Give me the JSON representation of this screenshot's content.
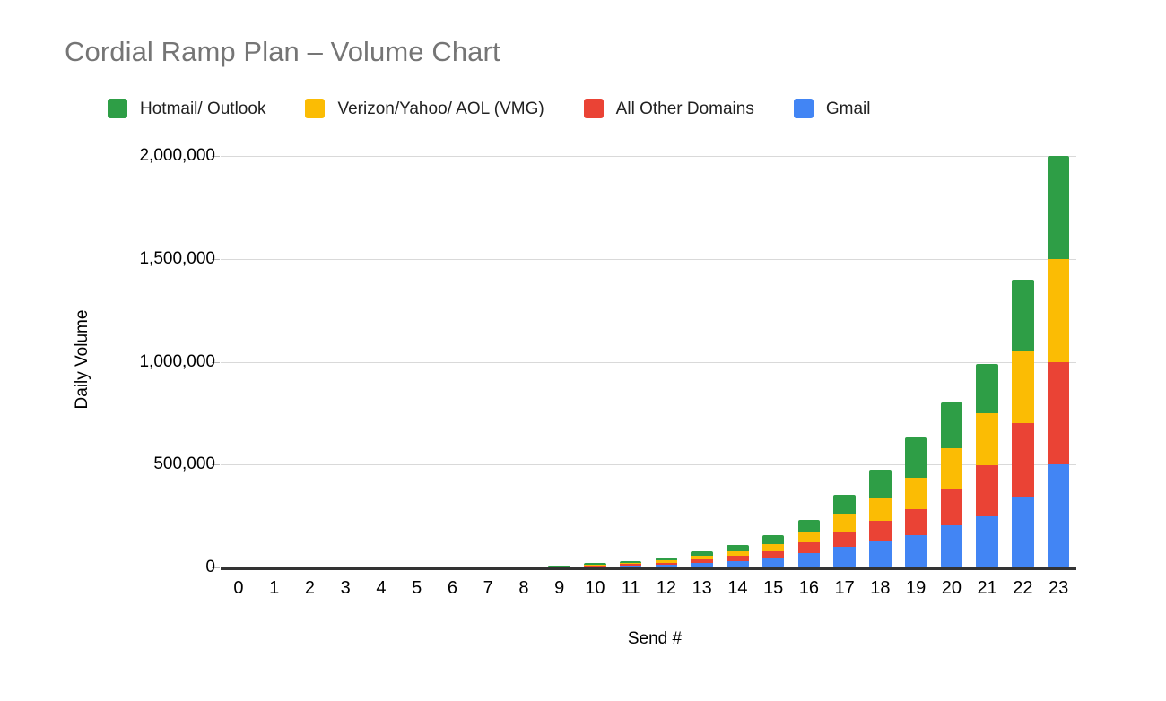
{
  "chart_data": {
    "type": "bar",
    "stacked": true,
    "title": "Cordial Ramp Plan – Volume Chart",
    "xlabel": "Send #",
    "ylabel": "Daily Volume",
    "ylim": [
      0,
      2000000
    ],
    "grid": true,
    "legend_position": "top",
    "categories": [
      "0",
      "1",
      "2",
      "3",
      "4",
      "5",
      "6",
      "7",
      "8",
      "9",
      "10",
      "11",
      "12",
      "13",
      "14",
      "15",
      "16",
      "17",
      "18",
      "19",
      "20",
      "21",
      "22",
      "23"
    ],
    "ytick_labels": [
      "0",
      "500,000",
      "1,000,000",
      "1,500,000",
      "2,000,000"
    ],
    "ytick_values": [
      0,
      500000,
      1000000,
      1500000,
      2000000
    ],
    "series": [
      {
        "name": "Gmail",
        "color": "#4285F4",
        "values": [
          0,
          0,
          0,
          0,
          0,
          0,
          0,
          0,
          0,
          1000,
          4000,
          8000,
          12000,
          20000,
          30000,
          45000,
          70000,
          100000,
          125000,
          155000,
          205000,
          250000,
          345000,
          500000
        ]
      },
      {
        "name": "All Other Domains",
        "color": "#EA4335",
        "values": [
          0,
          0,
          0,
          0,
          0,
          0,
          0,
          0,
          1000,
          2500,
          5000,
          8000,
          12000,
          18000,
          25000,
          35000,
          50000,
          75000,
          100000,
          130000,
          175000,
          245000,
          355000,
          500000
        ]
      },
      {
        "name": "Verizon/Yahoo/ AOL (VMG)",
        "color": "#FBBC04",
        "values": [
          0,
          0,
          0,
          0,
          0,
          0,
          0,
          0,
          2500,
          2500,
          5000,
          8000,
          12000,
          18000,
          25000,
          35000,
          55000,
          85000,
          115000,
          150000,
          200000,
          255000,
          350000,
          500000
        ]
      },
      {
        "name": "Hotmail/ Outlook",
        "color": "#2E9E46",
        "values": [
          0,
          0,
          0,
          0,
          0,
          0,
          0,
          0,
          1000,
          4000,
          6000,
          8000,
          14000,
          24000,
          30000,
          40000,
          55000,
          95000,
          135000,
          195000,
          220000,
          240000,
          350000,
          500000
        ]
      }
    ],
    "totals": [
      0,
      0,
      0,
      0,
      0,
      0,
      0,
      0,
      4500,
      10000,
      20000,
      32000,
      50000,
      80000,
      110000,
      155000,
      230000,
      355000,
      475000,
      630000,
      800000,
      990000,
      1400000,
      2000000
    ]
  },
  "legend": {
    "items": [
      {
        "label": "Hotmail/ Outlook",
        "color": "#2E9E46"
      },
      {
        "label": "Verizon/Yahoo/ AOL (VMG)",
        "color": "#FBBC04"
      },
      {
        "label": "All Other Domains",
        "color": "#EA4335"
      },
      {
        "label": "Gmail",
        "color": "#4285F4"
      }
    ]
  },
  "colors": {
    "title": "#757575",
    "text": "#212121",
    "grid": "#d9d9d9",
    "baseline": "#333333",
    "background": "#ffffff"
  }
}
